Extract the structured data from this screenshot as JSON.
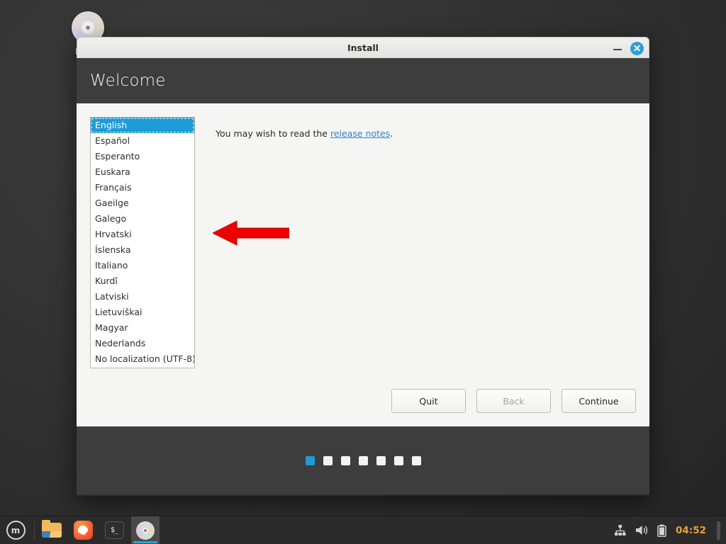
{
  "desktop": {
    "icon": {
      "label": "Install",
      "glyph": "cd-disc-icon"
    }
  },
  "window": {
    "title": "Install",
    "minimize_label": "Minimize",
    "close_label": "Close",
    "page_title": "Welcome",
    "languages": [
      "English",
      "Español",
      "Esperanto",
      "Euskara",
      "Français",
      "Gaeilge",
      "Galego",
      "Hrvatski",
      "Íslenska",
      "Italiano",
      "Kurdî",
      "Latviski",
      "Lietuviškai",
      "Magyar",
      "Nederlands",
      "No localization (UTF-8)"
    ],
    "selected_language": "English",
    "release_text_before": "You may wish to read the ",
    "release_link": "release notes",
    "release_text_after": ".",
    "buttons": {
      "quit": "Quit",
      "back": "Back",
      "continue": "Continue"
    },
    "pager": {
      "total": 7,
      "active_index": 1
    },
    "accent_color": "#1e9bd7"
  },
  "taskbar": {
    "menu_label": "Menu",
    "launchers": [
      {
        "name": "files-icon",
        "label": "Files"
      },
      {
        "name": "firefox-icon",
        "label": "Firefox Web Browser"
      },
      {
        "name": "terminal-icon",
        "label": "Terminal",
        "glyph": "$_"
      },
      {
        "name": "installer-window-icon",
        "label": "Install",
        "active": true
      }
    ],
    "tray": {
      "network_label": "Network",
      "volume_label": "Volume",
      "battery_label": "Battery",
      "clock": "04:52",
      "clock_color": "#e8a13c"
    }
  }
}
